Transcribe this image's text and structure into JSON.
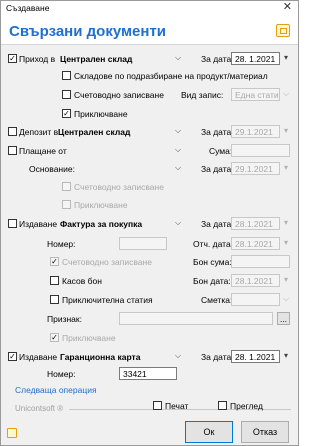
{
  "window": {
    "title": "Създаване",
    "close_glyph": "✕"
  },
  "header": {
    "title": "Свързани документи",
    "icon": "linked-documents-icon"
  },
  "main": {
    "receipt": {
      "checked": true,
      "label": "Приход в",
      "target": "Централен склад",
      "date_label": "За дата:",
      "date_value": "28. 1.2021",
      "default_warehouses_label": "Складове по подразбиране на продукт/материал",
      "accounting_label": "Счетоводно записване",
      "entry_type_label": "Вид запис:",
      "entry_type_value": "Една статия",
      "close_label": "Приключване"
    },
    "deposit": {
      "label": "Депозит в",
      "target": "Централен склад",
      "date_label": "За дата:",
      "date_value": "29.1.2021"
    },
    "payment": {
      "label": "Плащане от",
      "amount_label": "Сума:",
      "reason_label": "Основание:",
      "date_label": "За дата:",
      "date_value": "29.1.2021",
      "accounting_label": "Счетоводно записване",
      "close_label": "Приключване"
    },
    "invoice": {
      "label": "Издаване",
      "doc_type": "Фактура за покупка",
      "date_label": "За дата:",
      "date_value": "28.1.2021",
      "number_label": "Номер:",
      "tax_date_label": "Отч. дата:",
      "tax_date_value": "28.1.2021",
      "accounting_label": "Счетоводно записване",
      "vat_amount_label": "Бон сума:",
      "cash_receipt_label": "Касов бон",
      "receipt_date_label": "Бон дата:",
      "receipt_date_value": "28.1.2021",
      "closing_entry_label": "Приключителна статия",
      "account_label": "Сметка:",
      "attribute_label": "Признак:",
      "browse_label": "...",
      "close_label": "Приключване"
    },
    "warranty": {
      "checked": true,
      "label": "Издаване",
      "doc_type": "Гаранционна карта",
      "date_label": "За дата:",
      "date_value": "28. 1.2021",
      "number_label": "Номер:",
      "number_value": "33421"
    },
    "next_operation_link": "Следваща операция"
  },
  "footer": {
    "brand": "Unicontsoft ®",
    "print_label": "Печат",
    "preview_label": "Преглед",
    "ok_label": "Ок",
    "cancel_label": "Отказ"
  }
}
